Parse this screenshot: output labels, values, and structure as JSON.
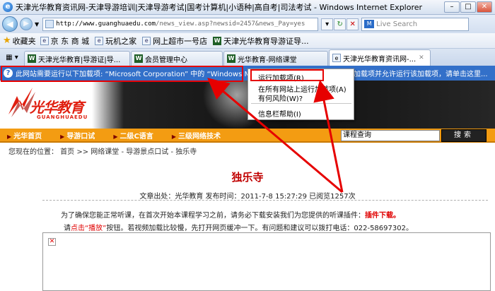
{
  "window": {
    "title": "天津光华教育资讯网-天津导游培训|天津导游考试|国考计算机|小语种|高自考|司法考试 - Windows Internet Explorer",
    "minimize": "–",
    "maximize": "□",
    "close": "✕"
  },
  "address": {
    "url_domain": "http://www.guanghuaedu.com",
    "url_path": "/news_view.asp?newsid=2457&news_Pay=yes",
    "search_placeholder": "Live Search",
    "search_brand": "M"
  },
  "favorites": {
    "label": "收藏夹",
    "items": [
      {
        "label": "京 东 商 城",
        "icon": "e"
      },
      {
        "label": "玩机之家",
        "icon": "e"
      },
      {
        "label": "网上超市一号店",
        "icon": "e"
      },
      {
        "label": "天津光华教育导游证导...",
        "icon": "W"
      }
    ]
  },
  "tabs": [
    {
      "label": "天津光华教育|导游证|导...",
      "icon": "W"
    },
    {
      "label": "会员管理中心",
      "icon": "W"
    },
    {
      "label": "光华教育-网络课堂",
      "icon": "W"
    },
    {
      "label": "天津光华教育资讯网-...",
      "icon": "e",
      "active": true
    }
  ],
  "infobar": {
    "text": "此网站需要运行以下加载项: “Microsoft Corporation” 中的 “Windows Media",
    "text_tail": "加载项并允许运行该加载项，请单击这里..."
  },
  "context_menu": {
    "items": [
      "运行加载项(R)",
      "在所有网站上运行加载项(A)",
      "有何风险(W)?",
      "信息栏帮助(I)"
    ]
  },
  "site": {
    "logo_text": "光华教育",
    "logo_sub": "GUANGHUAEDU",
    "nav": [
      "光华首页",
      "导游口试",
      "二级C语言",
      "三级网络技术"
    ],
    "search_value": "课程查询",
    "search_button": "搜索"
  },
  "breadcrumb": "您现在的位置： 首页 >> 网络课堂 - 导游景点口试 - 独乐寺",
  "article": {
    "title": "独乐寺",
    "meta": "文章出处：光华教育   发布时间：2011-7-8 15:27:29   已阅览1257次",
    "notice1_a": "为了确保您能正常听课，在首次开始本课程学习之前，请务必下载安装我们为您提供的听课插件：",
    "notice1_b": "插件下载。",
    "notice2_a": "请",
    "notice2_b": "点击“播放”",
    "notice2_c": "按钮。若视频加载比较慢，先打开网页缓冲一下。有问题和建议可以拨打电话：022-58697302。"
  }
}
